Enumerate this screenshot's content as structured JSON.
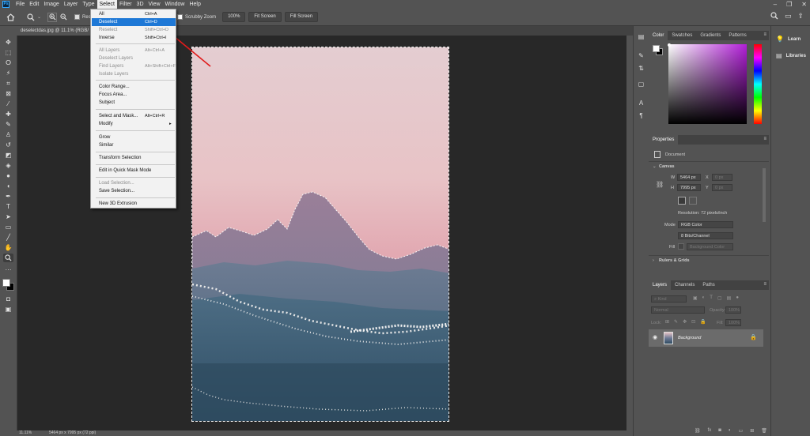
{
  "menubar": {
    "app_icon": "Ps",
    "items": [
      "File",
      "Edit",
      "Image",
      "Layer",
      "Type",
      "Select",
      "Filter",
      "3D",
      "View",
      "Window",
      "Help"
    ],
    "active": "Select"
  },
  "options": {
    "resize_label": "Resi",
    "scrubby_label": "Scrubby Zoom",
    "zoom_value": "100%",
    "fit_label": "Fit Screen",
    "fill_label": "Fill Screen"
  },
  "document": {
    "tab": "deselectdas.jpg @ 11.1% (RGB/",
    "status_zoom": "11.11%",
    "status_size": "5464 px x 7995 px (72 ppi)"
  },
  "select_menu": [
    {
      "label": "All",
      "shortcut": "Ctrl+A",
      "state": "normal"
    },
    {
      "label": "Deselect",
      "shortcut": "Ctrl+D",
      "state": "highlight"
    },
    {
      "label": "Reselect",
      "shortcut": "Shift+Ctrl+D",
      "state": "disabled"
    },
    {
      "label": "Inverse",
      "shortcut": "Shift+Ctrl+I",
      "state": "normal"
    },
    {
      "label": "All Layers",
      "shortcut": "Alt+Ctrl+A",
      "state": "disabled"
    },
    {
      "label": "Deselect Layers",
      "shortcut": "",
      "state": "disabled"
    },
    {
      "label": "Find Layers",
      "shortcut": "Alt+Shift+Ctrl+F",
      "state": "disabled"
    },
    {
      "label": "Isolate Layers",
      "shortcut": "",
      "state": "disabled"
    },
    {
      "label": "Color Range...",
      "shortcut": "",
      "state": "normal"
    },
    {
      "label": "Focus Area...",
      "shortcut": "",
      "state": "normal"
    },
    {
      "label": "Subject",
      "shortcut": "",
      "state": "normal"
    },
    {
      "label": "Select and Mask...",
      "shortcut": "Alt+Ctrl+R",
      "state": "normal"
    },
    {
      "label": "Modify",
      "shortcut": "▸",
      "state": "normal"
    },
    {
      "label": "Grow",
      "shortcut": "",
      "state": "normal"
    },
    {
      "label": "Similar",
      "shortcut": "",
      "state": "normal"
    },
    {
      "label": "Transform Selection",
      "shortcut": "",
      "state": "normal"
    },
    {
      "label": "Edit in Quick Mask Mode",
      "shortcut": "",
      "state": "normal"
    },
    {
      "label": "Load Selection...",
      "shortcut": "",
      "state": "disabled"
    },
    {
      "label": "Save Selection...",
      "shortcut": "",
      "state": "normal"
    },
    {
      "label": "New 3D Extrusion",
      "shortcut": "",
      "state": "normal"
    }
  ],
  "color_panel": {
    "tabs": [
      "Color",
      "Swatches",
      "Gradients",
      "Patterns"
    ],
    "active_tab": "Color",
    "foreground": "#ffffff",
    "background": "#000000",
    "hue": "#b21fd8"
  },
  "properties_panel": {
    "title": "Properties",
    "document_label": "Document",
    "canvas_heading": "Canvas",
    "w_label": "W",
    "w_value": "5464 px",
    "h_label": "H",
    "h_value": "7995 px",
    "x_label": "X",
    "x_value": "0 px",
    "y_label": "Y",
    "y_value": "0 px",
    "resolution": "Resolution: 72 pixels/inch",
    "mode_label": "Mode",
    "mode_value": "RGB Color",
    "depth_value": "8 Bits/Channel",
    "fill_label": "Fill",
    "fill_value": "Background Color",
    "rulers_heading": "Rulers & Grids"
  },
  "layers_panel": {
    "tabs": [
      "Layers",
      "Channels",
      "Paths"
    ],
    "active_tab": "Layers",
    "kind_label": "Kind",
    "blend_mode": "Normal",
    "opacity_label": "Opacity:",
    "opacity_value": "100%",
    "lock_label": "Lock:",
    "fill_label": "Fill:",
    "fill_value": "100%",
    "layer_name": "Background"
  },
  "learn_panel": {
    "items": [
      "Learn",
      "Libraries"
    ]
  }
}
